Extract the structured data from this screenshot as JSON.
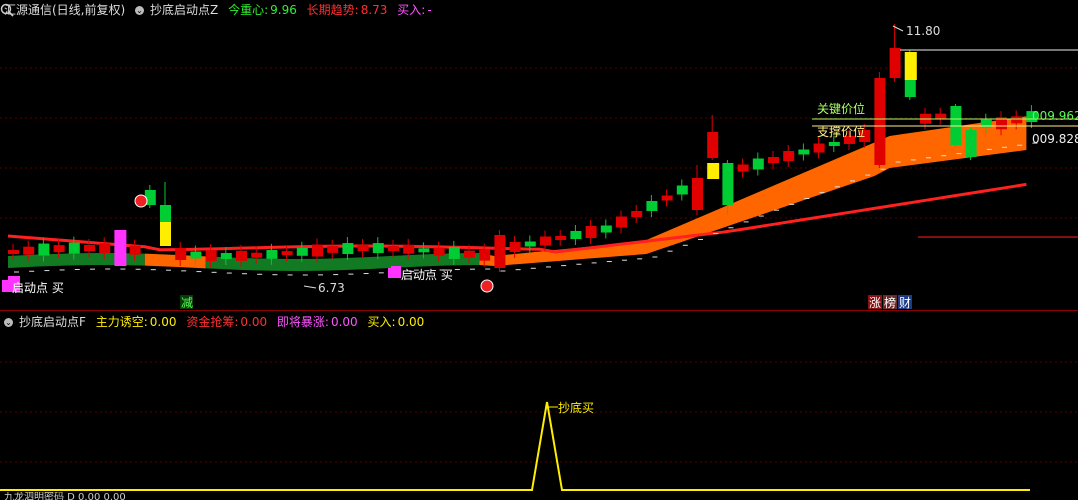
{
  "header_main": {
    "symbol": "汇源通信(日线,前复权)",
    "indicator": "抄底启动点Z",
    "pivot_label": "今重心:",
    "pivot_value": "9.96",
    "trend_label": "长期趋势:",
    "trend_value": "8.73",
    "buy_label": "买入:",
    "buy_value": "-"
  },
  "header_sub": {
    "indicator": "抄底启动点F",
    "short_label": "主力诱空:",
    "short_value": "0.00",
    "grab_label": "资金抢筹:",
    "grab_value": "0.00",
    "surge_label": "即将暴涨:",
    "surge_value": "0.00",
    "buy_label": "买入:",
    "buy_value": "0.00"
  },
  "labels": {
    "high_price": "11.80",
    "low_price": "6.73",
    "key_price_label": "关键价位",
    "support_label": "支撑价位",
    "key_price_value": "009.962",
    "support_value": "009.828",
    "start_buy_1": "启动点 买",
    "start_buy_2": "启动点 买",
    "reduce": "减",
    "zhang": "涨",
    "bang": "榜",
    "cai": "财",
    "bottom_buy": "抄底买",
    "status_text": "九龙泗明密码 D 0.00 0.00"
  },
  "colors": {
    "bg": "#000000",
    "up": "#e00000",
    "down": "#00cc33",
    "band": "#ff6600",
    "trend": "#ff2020",
    "yellow": "#ffee00",
    "magenta": "#ff33ff",
    "key_line": "#ffffa0",
    "support_line": "#ffffa0",
    "grid": "#5a0000"
  }
}
